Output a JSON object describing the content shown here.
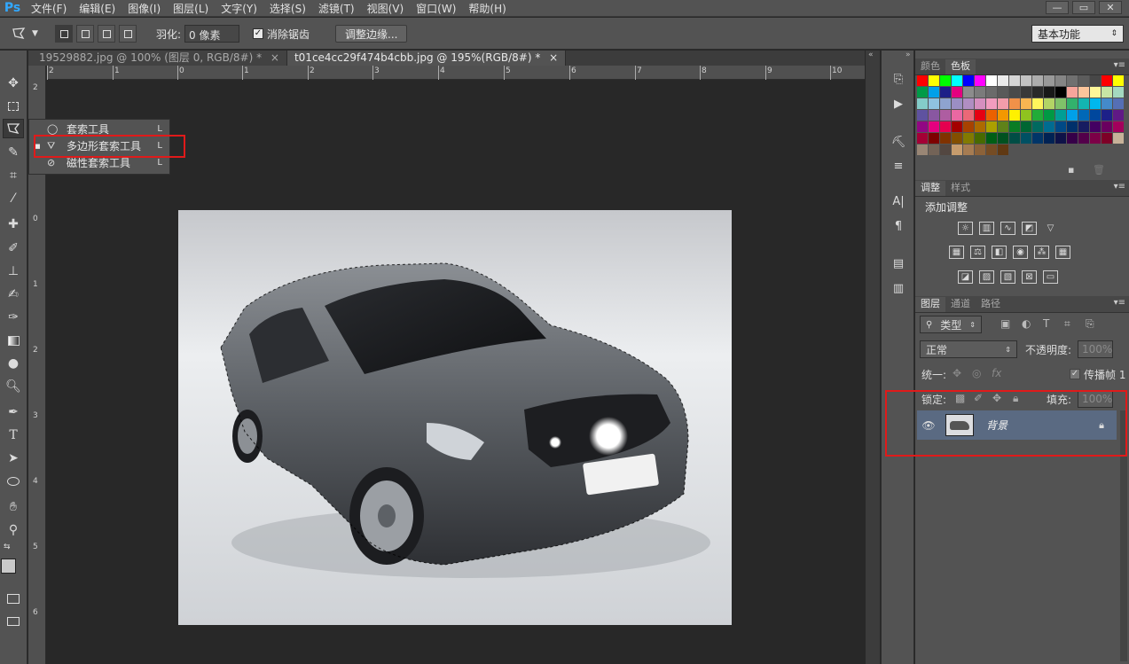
{
  "app": {
    "logo": "Ps"
  },
  "menu": [
    "文件(F)",
    "编辑(E)",
    "图像(I)",
    "图层(L)",
    "文字(Y)",
    "选择(S)",
    "滤镜(T)",
    "视图(V)",
    "窗口(W)",
    "帮助(H)"
  ],
  "window_controls": [
    "—",
    "▭",
    "✕"
  ],
  "options": {
    "feather_label": "羽化:",
    "feather_value": "0 像素",
    "antialias_label": "消除锯齿",
    "antialias_checked": true,
    "refine_edge_button": "调整边缘...",
    "workspace": "基本功能"
  },
  "tabs": [
    {
      "label": "19529882.jpg @ 100% (图层 0, RGB/8#) *",
      "close": "×",
      "active": false
    },
    {
      "label": "t01ce4cc29f474b4cbb.jpg @ 195%(RGB/8#) *",
      "close": "×",
      "active": true
    }
  ],
  "ruler_top": [
    "2",
    "1",
    "0",
    "1",
    "2",
    "3",
    "4",
    "5",
    "6",
    "7",
    "8",
    "9",
    "10"
  ],
  "ruler_left": [
    "2",
    "1",
    "0",
    "1",
    "2",
    "3",
    "4",
    "5",
    "6"
  ],
  "lasso_flyout": [
    {
      "label": "套索工具",
      "shortcut": "L",
      "icon": "lasso-icon"
    },
    {
      "label": "多边形套索工具",
      "shortcut": "L",
      "icon": "polygonal-lasso-icon",
      "selected": true
    },
    {
      "label": "磁性套索工具",
      "shortcut": "L",
      "icon": "magnetic-lasso-icon"
    }
  ],
  "panels": {
    "swatch_tabs": [
      "颜色",
      "色板"
    ],
    "adjust_tabs": [
      "调整",
      "样式"
    ],
    "adjust_title": "添加调整",
    "layers_tabs": [
      "图层",
      "通道",
      "路径"
    ],
    "layer_filter": "类型",
    "blend_mode": "正常",
    "opacity_label": "不透明度:",
    "opacity_value": "100%",
    "unify_label": "统一:",
    "propagate_label": "传播帧 1",
    "lock_label": "锁定:",
    "fill_label": "填充:",
    "fill_value": "100%",
    "layer_name": "背景"
  },
  "swatches": [
    "#ff0000",
    "#ffff00",
    "#00ff00",
    "#00ffff",
    "#0000ff",
    "#ff00ff",
    "#ffffff",
    "#ebebeb",
    "#d6d6d6",
    "#c2c2c2",
    "#adadad",
    "#999999",
    "#858585",
    "#707070",
    "#5c5c5c",
    "#474747",
    "#ff0000",
    "#ffff00",
    "#009b48",
    "#00a0e9",
    "#1d2088",
    "#e4007f",
    "#8c8c8c",
    "#7b7b7b",
    "#6b6b6b",
    "#5a5a5a",
    "#4a4a4a",
    "#393939",
    "#292929",
    "#181818",
    "#000000",
    "#f7a59b",
    "#fbc59b",
    "#fff799",
    "#c7e5a4",
    "#a4d9c0",
    "#84ccc9",
    "#8fc2e0",
    "#8ea3d0",
    "#9b8ec3",
    "#b08ec2",
    "#d68fbf",
    "#f29cbf",
    "#f39dab",
    "#f19149",
    "#f8b551",
    "#fff45c",
    "#b3d465",
    "#80c269",
    "#32b16c",
    "#13b5b1",
    "#00b7ee",
    "#448aca",
    "#556fb5",
    "#5f52a0",
    "#8957a1",
    "#ae5da1",
    "#ea68a2",
    "#eb6877",
    "#e60012",
    "#eb6100",
    "#f39800",
    "#fff100",
    "#8fc31f",
    "#22ac38",
    "#009944",
    "#009e96",
    "#00a0e9",
    "#0068b7",
    "#00479d",
    "#1d2088",
    "#601986",
    "#920783",
    "#e4007f",
    "#e5004f",
    "#a40000",
    "#a84200",
    "#ad6a00",
    "#aba000",
    "#5f8219",
    "#097c25",
    "#006633",
    "#00695f",
    "#006c91",
    "#004986",
    "#00306b",
    "#171c61",
    "#440062",
    "#6a005f",
    "#a3005c",
    "#a40035",
    "#7d0000",
    "#803200",
    "#834f00",
    "#827a00",
    "#486a00",
    "#005e15",
    "#005120",
    "#004d45",
    "#005063",
    "#003568",
    "#002254",
    "#0e1248",
    "#360048",
    "#53004a",
    "#7c0047",
    "#7e0027",
    "#c7b299",
    "#998675",
    "#736357",
    "#534741",
    "#c69c6d",
    "#a67c52",
    "#8c6239",
    "#754c24",
    "#603913"
  ]
}
